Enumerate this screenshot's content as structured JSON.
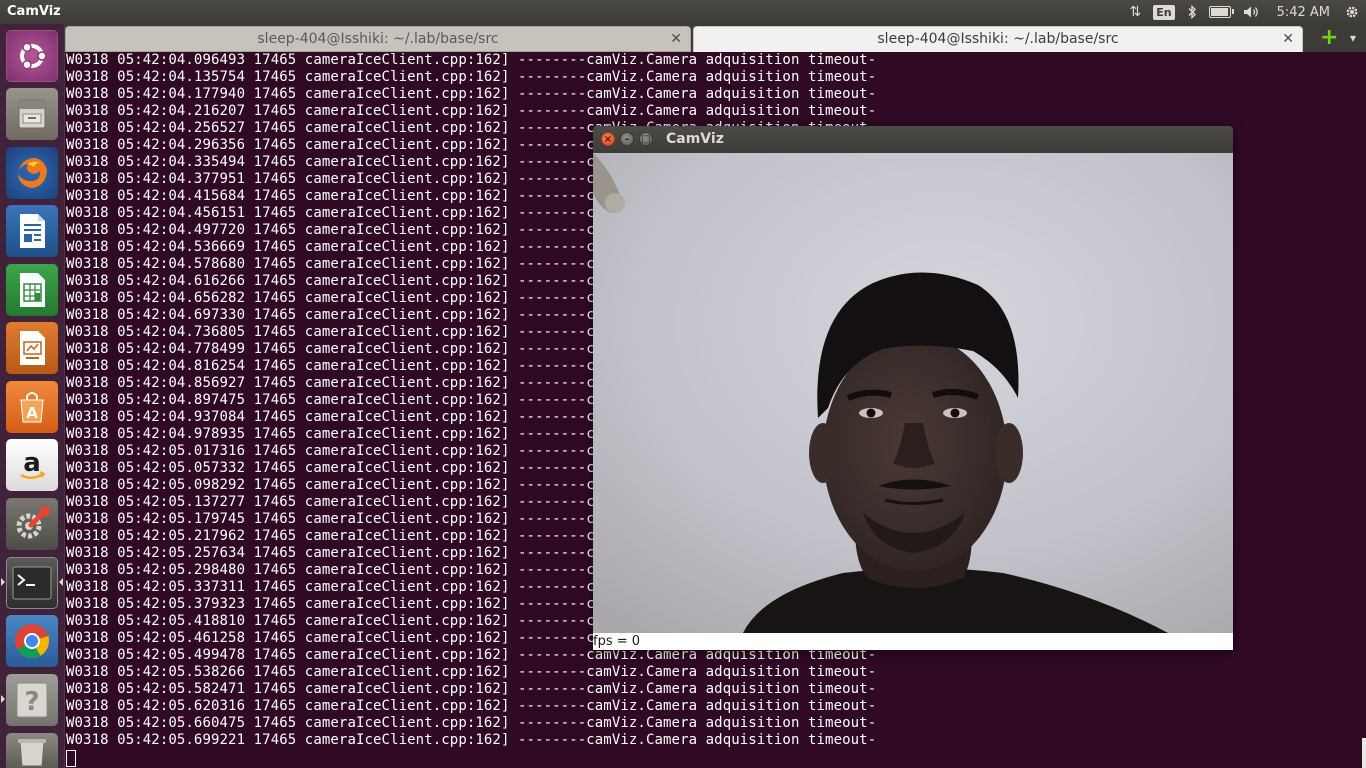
{
  "top_panel": {
    "app_title": "CamViz",
    "keyboard_layout": "En",
    "time": "5:42 AM"
  },
  "launcher": {
    "items": [
      {
        "name": "ubuntu-dash",
        "icon": "ubuntu-logo-icon"
      },
      {
        "name": "files",
        "icon": "file-cabinet-icon"
      },
      {
        "name": "firefox",
        "icon": "firefox-icon"
      },
      {
        "name": "libreoffice-writer",
        "icon": "writer-document-icon"
      },
      {
        "name": "libreoffice-calc",
        "icon": "calc-spreadsheet-icon"
      },
      {
        "name": "libreoffice-impress",
        "icon": "impress-presentation-icon"
      },
      {
        "name": "ubuntu-software",
        "icon": "shopping-bag-icon"
      },
      {
        "name": "amazon",
        "icon": "amazon-icon"
      },
      {
        "name": "system-settings",
        "icon": "settings-wrench-icon"
      },
      {
        "name": "terminal",
        "icon": "terminal-icon"
      },
      {
        "name": "chrome",
        "icon": "chrome-icon"
      },
      {
        "name": "help",
        "icon": "help-question-icon"
      }
    ]
  },
  "terminal": {
    "tabs": [
      {
        "label": "sleep-404@Isshiki: ~/.lab/base/src"
      },
      {
        "label": "sleep-404@Isshiki: ~/.lab/base/src"
      }
    ],
    "log_lines": [
      "W0318 05:42:04.096493 17465 cameraIceClient.cpp:162] --------camViz.Camera adquisition timeout-",
      "W0318 05:42:04.135754 17465 cameraIceClient.cpp:162] --------camViz.Camera adquisition timeout-",
      "W0318 05:42:04.177940 17465 cameraIceClient.cpp:162] --------camViz.Camera adquisition timeout-",
      "W0318 05:42:04.216207 17465 cameraIceClient.cpp:162] --------camViz.Camera adquisition timeout-",
      "W0318 05:42:04.256527 17465 cameraIceClient.cpp:162] --------camViz.Camera adquisition timeout-",
      "W0318 05:42:04.296356 17465 cameraIceClient.cpp:162] --------camViz.Camera adquisition timeout-",
      "W0318 05:42:04.335494 17465 cameraIceClient.cpp:162] --------camViz.Camera adquisition timeout-",
      "W0318 05:42:04.377951 17465 cameraIceClient.cpp:162] --------camViz.Camera adquisition timeout-",
      "W0318 05:42:04.415684 17465 cameraIceClient.cpp:162] --------camViz.Camera adquisition timeout-",
      "W0318 05:42:04.456151 17465 cameraIceClient.cpp:162] --------camViz.Camera adquisition timeout-",
      "W0318 05:42:04.497720 17465 cameraIceClient.cpp:162] --------camViz.Camera adquisition timeout-",
      "W0318 05:42:04.536669 17465 cameraIceClient.cpp:162] --------camViz.Camera adquisition timeout-",
      "W0318 05:42:04.578680 17465 cameraIceClient.cpp:162] --------camViz.Camera adquisition timeout-",
      "W0318 05:42:04.616266 17465 cameraIceClient.cpp:162] --------camViz.Camera adquisition timeout-",
      "W0318 05:42:04.656282 17465 cameraIceClient.cpp:162] --------camViz.Camera adquisition timeout-",
      "W0318 05:42:04.697330 17465 cameraIceClient.cpp:162] --------camViz.Camera adquisition timeout-",
      "W0318 05:42:04.736805 17465 cameraIceClient.cpp:162] --------camViz.Camera adquisition timeout-",
      "W0318 05:42:04.778499 17465 cameraIceClient.cpp:162] --------camViz.Camera adquisition timeout-",
      "W0318 05:42:04.816254 17465 cameraIceClient.cpp:162] --------camViz.Camera adquisition timeout-",
      "W0318 05:42:04.856927 17465 cameraIceClient.cpp:162] --------camViz.Camera adquisition timeout-",
      "W0318 05:42:04.897475 17465 cameraIceClient.cpp:162] --------camViz.Camera adquisition timeout-",
      "W0318 05:42:04.937084 17465 cameraIceClient.cpp:162] --------camViz.Camera adquisition timeout-",
      "W0318 05:42:04.978935 17465 cameraIceClient.cpp:162] --------camViz.Camera adquisition timeout-",
      "W0318 05:42:05.017316 17465 cameraIceClient.cpp:162] --------camViz.Camera adquisition timeout-",
      "W0318 05:42:05.057332 17465 cameraIceClient.cpp:162] --------camViz.Camera adquisition timeout-",
      "W0318 05:42:05.098292 17465 cameraIceClient.cpp:162] --------camViz.Camera adquisition timeout-",
      "W0318 05:42:05.137277 17465 cameraIceClient.cpp:162] --------camViz.Camera adquisition timeout-",
      "W0318 05:42:05.179745 17465 cameraIceClient.cpp:162] --------camViz.Camera adquisition timeout-",
      "W0318 05:42:05.217962 17465 cameraIceClient.cpp:162] --------camViz.Camera adquisition timeout-",
      "W0318 05:42:05.257634 17465 cameraIceClient.cpp:162] --------camViz.Camera adquisition timeout-",
      "W0318 05:42:05.298480 17465 cameraIceClient.cpp:162] --------camViz.Camera adquisition timeout-",
      "W0318 05:42:05.337311 17465 cameraIceClient.cpp:162] --------camViz.Camera adquisition timeout-",
      "W0318 05:42:05.379323 17465 cameraIceClient.cpp:162] --------camViz.Camera adquisition timeout-",
      "W0318 05:42:05.418810 17465 cameraIceClient.cpp:162] --------camViz.Camera adquisition timeout-",
      "W0318 05:42:05.461258 17465 cameraIceClient.cpp:162] --------camViz.Camera adquisition timeout-",
      "W0318 05:42:05.499478 17465 cameraIceClient.cpp:162] --------camViz.Camera adquisition timeout-",
      "W0318 05:42:05.538266 17465 cameraIceClient.cpp:162] --------camViz.Camera adquisition timeout-",
      "W0318 05:42:05.582471 17465 cameraIceClient.cpp:162] --------camViz.Camera adquisition timeout-",
      "W0318 05:42:05.620316 17465 cameraIceClient.cpp:162] --------camViz.Camera adquisition timeout-",
      "W0318 05:42:05.660475 17465 cameraIceClient.cpp:162] --------camViz.Camera adquisition timeout-",
      "W0318 05:42:05.699221 17465 cameraIceClient.cpp:162] --------camViz.Camera adquisition timeout-"
    ]
  },
  "camviz_window": {
    "title": "CamViz",
    "status": "fps = 0"
  },
  "colors": {
    "terminal_bg": "#300a24",
    "launcher_bg": "#40223a",
    "panel_bg": "#3c3b37",
    "close_button": "#df4a16",
    "new_tab_plus": "#73d216"
  }
}
